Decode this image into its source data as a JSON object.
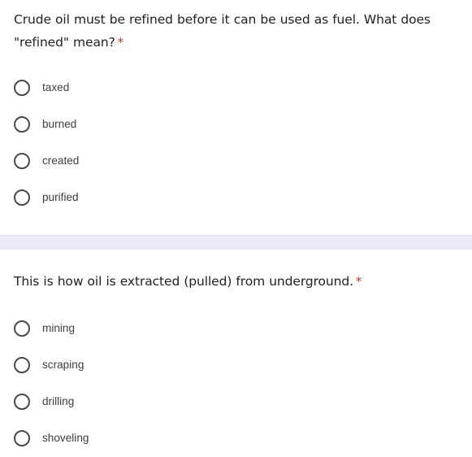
{
  "page": {
    "background_color": "#ffffff",
    "required_marker": "*",
    "required_marker_color": "#d93025",
    "separator_color": "#eceaf7"
  },
  "questions": [
    {
      "title": "Crude oil must be refined before it can be used as fuel. What does \"refined\" mean?",
      "required": true,
      "input_type": "radio",
      "options": [
        {
          "label": "taxed",
          "selected": false
        },
        {
          "label": "burned",
          "selected": false
        },
        {
          "label": "created",
          "selected": false
        },
        {
          "label": "purified",
          "selected": false
        }
      ]
    },
    {
      "title": "This is how oil is extracted (pulled) from underground.",
      "required": true,
      "input_type": "radio",
      "options": [
        {
          "label": "mining",
          "selected": false
        },
        {
          "label": "scraping",
          "selected": false
        },
        {
          "label": "drilling",
          "selected": false
        },
        {
          "label": "shoveling",
          "selected": false
        }
      ]
    }
  ]
}
